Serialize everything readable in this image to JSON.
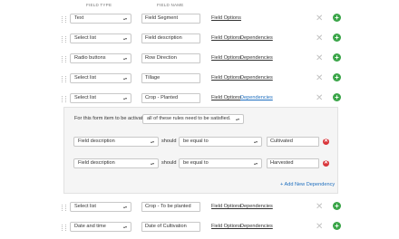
{
  "header": {
    "field_type": "FIELD TYPE",
    "field_name": "FIELD NAME"
  },
  "rows": [
    {
      "type": "Text",
      "name": "Field Segment",
      "options": "Field Options",
      "deps": ""
    },
    {
      "type": "Select list",
      "name": "Field description",
      "options": "Field Options",
      "deps": "Dependencies"
    },
    {
      "type": "Radio buttons",
      "name": "Row Direction",
      "options": "Field Options",
      "deps": "Dependencies"
    },
    {
      "type": "Select list",
      "name": "Tillage",
      "options": "Field Options",
      "deps": "Dependencies"
    },
    {
      "type": "Select list",
      "name": "Crop - Planted",
      "options": "Field Options",
      "deps": "Dependencies"
    },
    {
      "type": "Select list",
      "name": "Crop - To be planted",
      "options": "Field Options",
      "deps": "Dependencies"
    },
    {
      "type": "Date and time",
      "name": "Date of Cultivation",
      "options": "Field Options",
      "deps": "Dependencies"
    }
  ],
  "dependency_panel": {
    "intro": "For this form item to be activated",
    "rule_select": "all of these rules need to be satisfied.",
    "rules": [
      {
        "field": "Field description",
        "should": "should",
        "op": "be equal to",
        "value": "Cultivated"
      },
      {
        "field": "Field description",
        "should": "should",
        "op": "be equal to",
        "value": "Harvested"
      }
    ],
    "add": "+ Add New Dependency"
  },
  "icons": {
    "remove": "close-icon",
    "add": "plus-circle-icon",
    "rule_remove": "remove-circle-icon",
    "drag": "drag-handle-icon"
  },
  "colors": {
    "add_green": "#3aa548",
    "link_blue": "#1f6fbf",
    "remove_red": "#d9353a"
  }
}
